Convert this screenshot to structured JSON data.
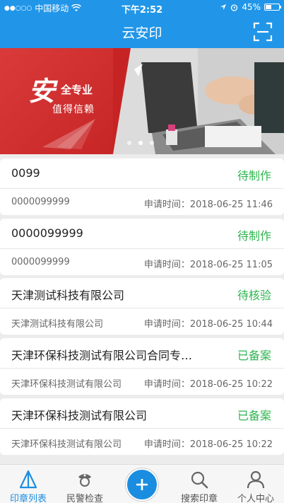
{
  "status_bar": {
    "carrier": "中国移动",
    "time": "下午2:52",
    "battery": "45%",
    "battery_level": 0.45
  },
  "nav": {
    "title": "云安印",
    "scan_icon": "scan-icon"
  },
  "banner": {
    "big_char": "安",
    "line1": "全专业",
    "line2": "值得信赖",
    "slide_count": 3,
    "active_slide": 2
  },
  "records": [
    {
      "title": "0099",
      "status": "待制作",
      "sub": "0000099999",
      "time_label": "申请时间：",
      "time": "2018-06-25 11:46"
    },
    {
      "title": "0000099999",
      "status": "待制作",
      "sub": "0000099999",
      "time_label": "申请时间：",
      "time": "2018-06-25 11:05"
    },
    {
      "title": "天津测试科技有限公司",
      "status": "待核验",
      "sub": "天津测试科技有限公司",
      "time_label": "申请时间：",
      "time": "2018-06-25 10:44"
    },
    {
      "title": "天津环保科技测试有限公司合同专…",
      "status": "已备案",
      "sub": "天津环保科技测试有限公司",
      "time_label": "申请时间：",
      "time": "2018-06-25 10:22"
    },
    {
      "title": "天津环保科技测试有限公司",
      "status": "已备案",
      "sub": "天津环保科技测试有限公司",
      "time_label": "申请时间：",
      "time": "2018-06-25 10:22"
    }
  ],
  "tabs": [
    {
      "label": "印章列表",
      "icon": "seal-list-icon",
      "active": true
    },
    {
      "label": "民警检查",
      "icon": "police-icon",
      "active": false
    },
    {
      "label": "",
      "icon": "add-icon",
      "active": false
    },
    {
      "label": "搜索印章",
      "icon": "search-icon",
      "active": false
    },
    {
      "label": "个人中心",
      "icon": "person-icon",
      "active": false
    }
  ],
  "colors": {
    "primary": "#2196e8",
    "status_green": "#2fb550",
    "banner_red": "#d93a3a"
  }
}
